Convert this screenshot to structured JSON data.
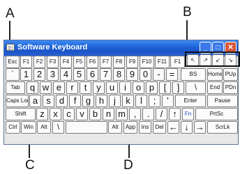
{
  "callouts": {
    "a": "A",
    "b": "B",
    "c": "C",
    "d": "D"
  },
  "window": {
    "title": "Software Keyboard",
    "minimize_glyph": "_",
    "maximize_glyph": "□",
    "close_glyph": "✕"
  },
  "rows": {
    "r1": [
      "Esc",
      "F1",
      "F2",
      "F3",
      "F4",
      "F5",
      "F6",
      "F7",
      "F8",
      "F9",
      "F10",
      "F11",
      "F1"
    ],
    "r1_icons": [
      "↖",
      "↗",
      "↙",
      "↘"
    ],
    "r2": [
      "`",
      "1",
      "2",
      "3",
      "4",
      "5",
      "6",
      "7",
      "8",
      "9",
      "0",
      "-",
      "=",
      "BS",
      "Home",
      "PUp"
    ],
    "r3": [
      "Tab",
      "q",
      "w",
      "e",
      "r",
      "t",
      "y",
      "u",
      "i",
      "o",
      "p",
      "[",
      "]",
      "\\",
      "End",
      "PDn"
    ],
    "r4": [
      "Caps Lock",
      "a",
      "s",
      "d",
      "f",
      "g",
      "h",
      "j",
      "k",
      "l",
      ";",
      "'",
      "Enter",
      "Pause"
    ],
    "r5": [
      "Shift",
      "z",
      "x",
      "c",
      "v",
      "b",
      "n",
      "m",
      ",",
      ".",
      "/",
      "↑",
      "Fn",
      "PrtSc"
    ],
    "r6": [
      "Ctrl",
      "Win",
      "Alt",
      "\\",
      "Alt",
      "App",
      "Ins",
      "Del",
      "←",
      "↓",
      "→",
      "ScrLk"
    ]
  }
}
